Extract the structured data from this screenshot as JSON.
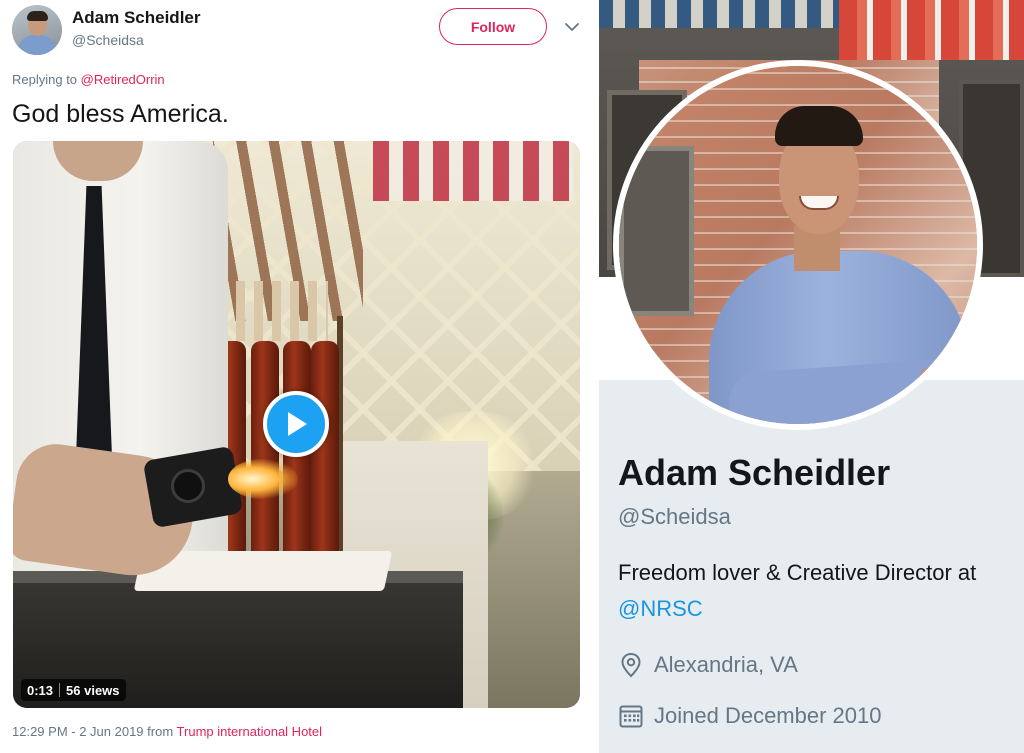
{
  "tweet": {
    "author": {
      "name": "Adam Scheidler",
      "handle": "@Scheidsa"
    },
    "follow_label": "Follow",
    "replying_prefix": "Replying to",
    "replying_to": "@RetiredOrrin",
    "text": "God bless America.",
    "video": {
      "duration": "0:13",
      "views": "56 views"
    },
    "timestamp": "12:29 PM - 2 Jun 2019 from",
    "source": "Trump international Hotel"
  },
  "profile": {
    "name": "Adam Scheidler",
    "handle": "@Scheidsa",
    "bio": "Freedom lover & Creative Director at",
    "bio_link": "@NRSC",
    "location": "Alexandria, VA",
    "joined": "Joined December 2010"
  },
  "icons": {
    "chevron": "chevron-down-icon",
    "play": "play-icon",
    "location": "location-pin-icon",
    "calendar": "calendar-icon"
  },
  "colors": {
    "accent_pink": "#e0245e",
    "link_blue": "#1b95e0",
    "play_blue": "#1da1f2",
    "muted": "#657786",
    "profile_panel": "#e6ecf0"
  }
}
